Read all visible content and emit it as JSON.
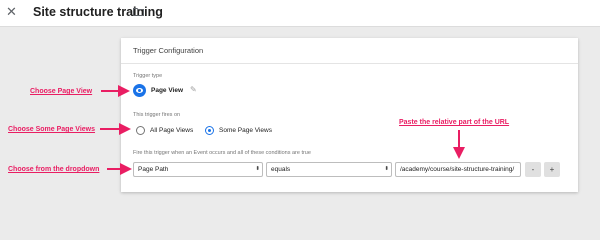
{
  "header": {
    "title": "Site structure training",
    "close_icon": "close-icon",
    "folder_icon": "folder-icon"
  },
  "panel": {
    "title": "Trigger Configuration",
    "trigger_type_label": "Trigger type",
    "trigger_type_value": "Page View",
    "fires_on_label": "This trigger fires on",
    "fires_on_options": [
      {
        "label": "All Page Views",
        "checked": false
      },
      {
        "label": "Some Page Views",
        "checked": true
      }
    ],
    "condition_label": "Fire this trigger when an Event occurs and all of these conditions are true",
    "condition": {
      "variable": "Page Path",
      "operator": "equals",
      "value": "/academy/course/site-structure-training/",
      "remove_label": "-",
      "add_label": "+"
    }
  },
  "annotations": {
    "choose_page_view": "Choose Page View",
    "choose_some_page_views": "Choose Some Page Views",
    "choose_dropdown": "Choose from the dropdown",
    "paste_relative": "Paste the relative part of the URL"
  },
  "colors": {
    "annotation": "#e91e63",
    "accent": "#1a73e8"
  }
}
